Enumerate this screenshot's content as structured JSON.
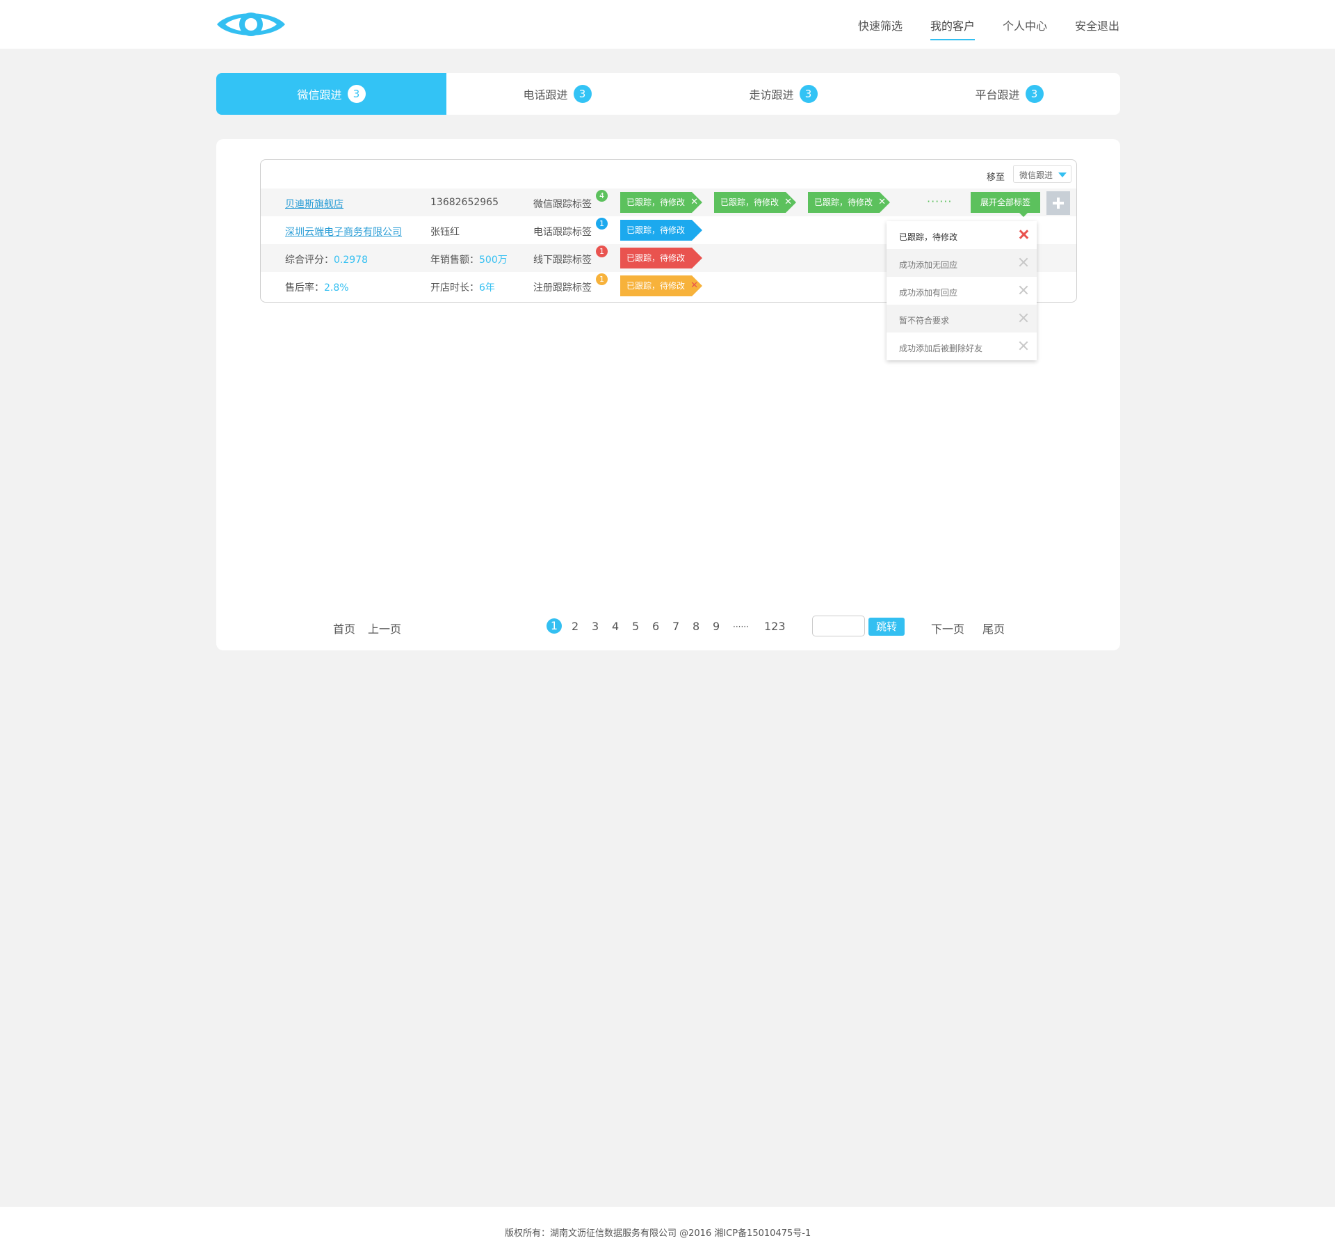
{
  "nav": {
    "items": [
      "快速筛选",
      "我的客户",
      "个人中心",
      "安全退出"
    ],
    "active": "我的客户"
  },
  "tabs": [
    {
      "label": "微信跟进",
      "count": "3"
    },
    {
      "label": "电话跟进",
      "count": "3"
    },
    {
      "label": "走访跟进",
      "count": "3"
    },
    {
      "label": "平台跟进",
      "count": "3"
    }
  ],
  "move": {
    "label": "移至",
    "selected": "微信跟进"
  },
  "customer": {
    "name": "贝迪斯旗舰店",
    "phone": "13682652965",
    "company": "深圳云端电子商务有限公司",
    "contact": "张钰红",
    "score_label": "综合评分：",
    "score": "0.2978",
    "sales_label": "年销售额：",
    "sales": "500万",
    "aftersale_label": "售后率：",
    "aftersale": "2.8%",
    "shop_age_label": "开店时长：",
    "shop_age": "6年"
  },
  "track_rows": [
    {
      "label": "微信跟踪标签",
      "count": "4",
      "color": "#5cc15d"
    },
    {
      "label": "电话跟踪标签",
      "count": "1",
      "color": "#1ca9ee"
    },
    {
      "label": "线下跟踪标签",
      "count": "1",
      "color": "#e9534f"
    },
    {
      "label": "注册跟踪标签",
      "count": "1",
      "color": "#f7b23b"
    }
  ],
  "tag_text": "已跟踪，待修改",
  "dots": "······",
  "expand_label": "展开全部标签",
  "dropdown": [
    "已跟踪，待修改",
    "成功添加无回应",
    "成功添加有回应",
    "暂不符合要求",
    "成功添加后被删除好友"
  ],
  "pager": {
    "first": "首页",
    "prev": "上一页",
    "pages": [
      "1",
      "2",
      "3",
      "4",
      "5",
      "6",
      "7",
      "8",
      "9"
    ],
    "ellipsis": "······",
    "last_page": "123",
    "jump": "跳转",
    "next": "下一页",
    "end": "尾页"
  },
  "footer": "版权所有：湖南文沥征信数据服务有限公司  @2016  湘ICP备15010475号-1",
  "colors": {
    "accent": "#33bff1",
    "green": "#5cc15d",
    "blue": "#1ca9ee",
    "red": "#e9534f",
    "orange": "#f7b23b"
  }
}
